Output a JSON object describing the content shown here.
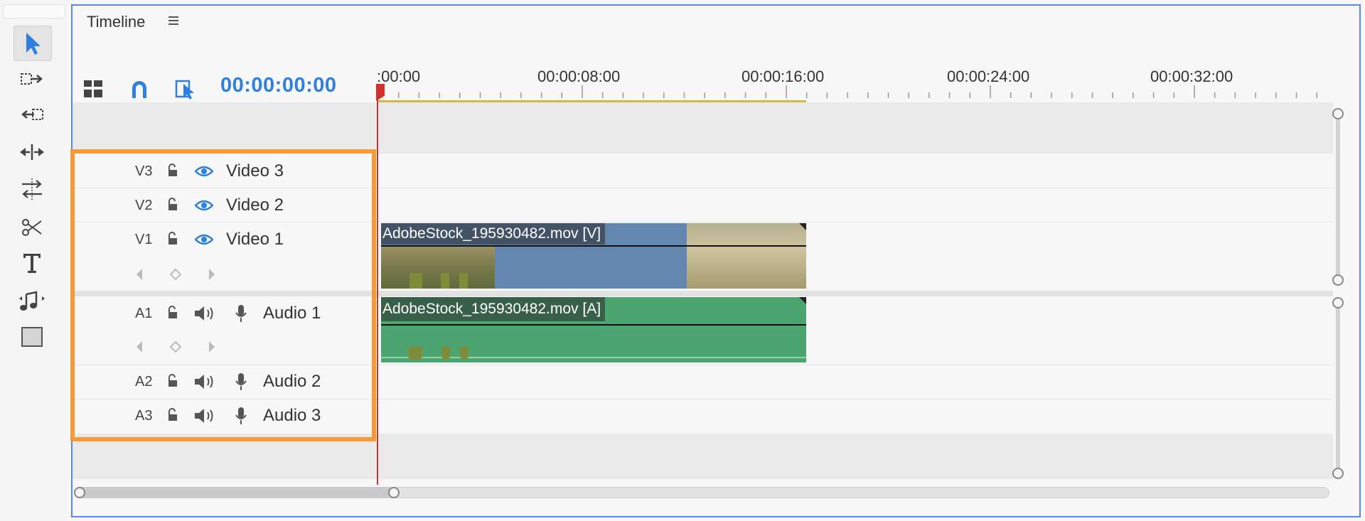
{
  "panel": {
    "title": "Timeline",
    "menu_icon": "hamburger-icon"
  },
  "toolbar": {
    "tools": [
      {
        "name": "selection-tool",
        "icon": "arrow-icon"
      },
      {
        "name": "track-select-forward-tool",
        "icon": "track-select-icon"
      },
      {
        "name": "ripple-edit-tool",
        "icon": "ripple-edit-icon"
      },
      {
        "name": "rolling-edit-tool",
        "icon": "rolling-edit-icon"
      },
      {
        "name": "slip-tool",
        "icon": "slip-icon"
      },
      {
        "name": "razor-tool",
        "icon": "scissors-icon"
      },
      {
        "name": "type-tool",
        "icon": "type-icon"
      },
      {
        "name": "remix-tool",
        "icon": "music-icon"
      },
      {
        "name": "rectangle-tool",
        "icon": "rectangle-icon"
      }
    ]
  },
  "timecode": "00:00:00:00",
  "controls": [
    "nest-sequence-icon",
    "snap-magnet-icon",
    "linked-selection-icon"
  ],
  "ruler": {
    "labels": [
      ":00:00",
      "00:00:08:00",
      "00:00:16:00",
      "00:00:24:00",
      "00:00:32:00"
    ]
  },
  "tracks": {
    "video": [
      {
        "id": "V3",
        "name": "Video 3",
        "lock_icon": "lock-open-icon",
        "eye_icon": "eye-icon"
      },
      {
        "id": "V2",
        "name": "Video 2",
        "lock_icon": "lock-open-icon",
        "eye_icon": "eye-icon"
      },
      {
        "id": "V1",
        "name": "Video 1",
        "lock_icon": "lock-open-icon",
        "eye_icon": "eye-icon"
      }
    ],
    "audio": [
      {
        "id": "A1",
        "name": "Audio 1",
        "speaker_icon": "speaker-icon",
        "mic_icon": "mic-icon"
      },
      {
        "id": "A2",
        "name": "Audio 2",
        "speaker_icon": "speaker-icon",
        "mic_icon": "mic-icon"
      },
      {
        "id": "A3",
        "name": "Audio 3",
        "speaker_icon": "speaker-icon",
        "mic_icon": "mic-icon"
      }
    ]
  },
  "clips": {
    "video": {
      "label": "AdobeStock_195930482.mov [V]"
    },
    "audio": {
      "label": "AdobeStock_195930482.mov [A]"
    }
  },
  "colors": {
    "accent": "#2f7fe0",
    "highlight": "#f59a34",
    "video_clip": "#6487b0",
    "audio_clip": "#4ca571",
    "playhead": "#d32f2f",
    "work_area": "#d6b93a"
  }
}
